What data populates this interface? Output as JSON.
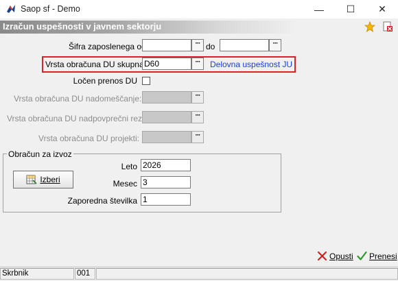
{
  "window": {
    "title": "Saop sf - Demo",
    "minimize": "—",
    "maximize": "☐",
    "close": "✕"
  },
  "header": {
    "title": "Izračun uspešnosti v javnem sektorju"
  },
  "form": {
    "sifra_label": "Šifra zaposlenega od :",
    "sifra_from": "",
    "do_label": "do",
    "sifra_to": "",
    "vrsta_skupna_label": "Vrsta obračuna DU skupna:",
    "vrsta_skupna_value": "D60",
    "vrsta_skupna_desc": "Delovna uspešnost JU",
    "locen_label": "Ločen prenos DU",
    "locen_checked": false,
    "nadomescanje_label": "Vrsta obračuna DU nadomeščanje:",
    "nadpovprecni_label": "Vrsta obračuna DU nadpovprečni rez.:",
    "projekti_label": "Vrsta obračuna DU projekti:",
    "dots": "···"
  },
  "export_group": {
    "title": "Obračun za izvoz",
    "izberi_label": "Izberi",
    "leto_label": "Leto",
    "leto_value": "2026",
    "mesec_label": "Mesec",
    "mesec_value": "3",
    "zaporedna_label": "Zaporedna številka",
    "zaporedna_value": "1"
  },
  "actions": {
    "opusti_label": "Opusti",
    "prenesi_label": "Prenesi"
  },
  "status": {
    "user": "Skrbnik",
    "company": "001"
  },
  "colors": {
    "highlight": "#d9232b",
    "link": "#1a3ee0",
    "cancel": "#d42020",
    "ok": "#2a9a2a"
  }
}
